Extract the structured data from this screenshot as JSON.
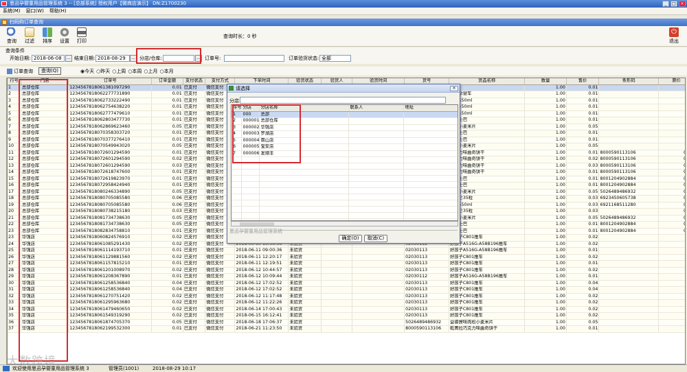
{
  "window": {
    "title": "思迅孕婴童用品管理系统 3 -- [总部系统] 授权用户【微商店演示】 DN:Z1700230"
  },
  "menu": [
    "系统(M)",
    "窗口(W)",
    "帮助(H)"
  ],
  "child_window": {
    "title": "扫码购订单查询"
  },
  "toolbar": {
    "items": [
      "查询",
      "过滤",
      "排序",
      "设置",
      "打印"
    ],
    "timer_label": "查询时长：",
    "timer_value": "0  秒",
    "exit": "退出"
  },
  "conditions": {
    "section": "查询条件",
    "start_label": "开始日期:",
    "start_value": "2018-06-08",
    "end_label": "结束日期:",
    "end_value": "2018-08-29",
    "branch_label": "分店/仓库:",
    "branch_value": "",
    "order_label": "订单号:",
    "order_value": "",
    "verify_label": "订单验货状态:",
    "verify_value": "全部"
  },
  "query_bar": {
    "tab": "订单查询",
    "query_btn": "查询(Q)",
    "periods": [
      "今天",
      "昨天",
      "上周",
      "本周",
      "上月",
      "本月"
    ]
  },
  "columns": [
    "行号",
    "门店",
    "订单号",
    "订单金额",
    "支付状态",
    "支付方式",
    "下单时间",
    "验货状态",
    "验货人",
    "验货时间",
    "货号",
    "货品名称",
    "数量",
    "售价",
    "条形码",
    "原价"
  ],
  "rows": [
    [
      "1",
      "总部仓库",
      "1234567818061381097290",
      "0.01",
      "已支付",
      "微信支付",
      "",
      "",
      "",
      "",
      "",
      "司乐",
      "1.00",
      "0.01",
      "",
      ""
    ],
    [
      "2",
      "总部仓库",
      "1234567818062277731890",
      "0.01",
      "已支付",
      "微信支付",
      "",
      "",
      "",
      "",
      "",
      "思迅孕婴车",
      "1.00",
      "0.01",
      "",
      ""
    ],
    [
      "3",
      "总部仓库",
      "1234567818062733222490",
      "0.01",
      "已支付",
      "微信支付",
      "",
      "",
      "",
      "",
      "",
      "山泉550ml",
      "1.00",
      "0.01",
      "",
      ""
    ],
    [
      "4",
      "总部仓库",
      "1234567818062754638220",
      "0.01",
      "已支付",
      "微信支付",
      "",
      "",
      "",
      "",
      "",
      "山泉550ml",
      "1.00",
      "0.01",
      "",
      ""
    ],
    [
      "5",
      "总部仓库",
      "1234567818062777479610",
      "0.01",
      "已支付",
      "微信支付",
      "",
      "",
      "",
      "",
      "",
      "山泉550ml",
      "1.00",
      "0.01",
      "",
      ""
    ],
    [
      "6",
      "总部仓库",
      "1234567818062803477730",
      "0.01",
      "已支付",
      "微信支付",
      "",
      "",
      "",
      "",
      "",
      "琪恩士巴",
      "1.00",
      "0.01",
      "",
      ""
    ],
    [
      "7",
      "总部仓库",
      "1234567818062869623460",
      "0.05",
      "已支付",
      "微信支付",
      "",
      "",
      "",
      "",
      "",
      "肉松小麦米片",
      "1.00",
      "0.05",
      "",
      ""
    ],
    [
      "8",
      "总部仓库",
      "1234567818070358303720",
      "0.01",
      "已支付",
      "微信支付",
      "",
      "",
      "",
      "",
      "",
      "琪恩士巴",
      "1.00",
      "0.01",
      "",
      ""
    ],
    [
      "9",
      "总部仓库",
      "1234567818070377276410",
      "0.01",
      "已支付",
      "微信支付",
      "",
      "",
      "",
      "",
      "",
      "琪恩士巴",
      "1.00",
      "0.01",
      "",
      ""
    ],
    [
      "10",
      "总部仓库",
      "1234567818070549943020",
      "0.05",
      "已支付",
      "微信支付",
      "",
      "",
      "",
      "",
      "",
      "肉松小麦米片",
      "1.00",
      "0.05",
      "",
      ""
    ],
    [
      "11",
      "总部仓库",
      "1234567818072601294590",
      "0.01",
      "已支付",
      "微信支付",
      "",
      "",
      "",
      "",
      "",
      "巧克力味曲奇饼干",
      "1.00",
      "0.01",
      "8000590113106",
      "0.02"
    ],
    [
      "12",
      "总部仓库",
      "1234567818072601294590",
      "0.02",
      "已支付",
      "微信支付",
      "",
      "",
      "",
      "",
      "",
      "巧克力味曲奇饼干",
      "1.00",
      "0.02",
      "8000590113106",
      "0.02"
    ],
    [
      "13",
      "总部仓库",
      "1234567818072601294590",
      "0.03",
      "已支付",
      "微信支付",
      "",
      "",
      "",
      "",
      "",
      "巧克力味曲奇饼干",
      "1.00",
      "0.03",
      "8000590113106",
      "0.02"
    ],
    [
      "14",
      "总部仓库",
      "1234567818072618747600",
      "0.01",
      "已支付",
      "微信支付",
      "",
      "",
      "",
      "",
      "",
      "巧克力味曲奇饼干",
      "1.00",
      "0.01",
      "8000590113106",
      "0.02"
    ],
    [
      "15",
      "总部仓库",
      "1234567818072619823970",
      "0.01",
      "已支付",
      "微信支付",
      "",
      "",
      "",
      "",
      "",
      "琪恩士巴",
      "1.00",
      "0.01",
      "8001204902884",
      "0.01"
    ],
    [
      "16",
      "总部仓库",
      "1234567818072958424940",
      "0.01",
      "已支付",
      "微信支付",
      "",
      "",
      "",
      "",
      "",
      "琪恩士巴",
      "1.00",
      "0.01",
      "8001204902884",
      "0.01"
    ],
    [
      "17",
      "总部仓库",
      "1234567818080246334890",
      "0.05",
      "已支付",
      "微信支付",
      "",
      "",
      "",
      "",
      "",
      "肉松小麦米片",
      "1.00",
      "0.05",
      "5026489486932",
      "0.05"
    ],
    [
      "18",
      "总部仓库",
      "1234567818080705085580",
      "0.06",
      "已支付",
      "微信支付",
      "",
      "",
      "",
      "",
      "",
      "果加仑35粒",
      "1.00",
      "0.03",
      "6923450605738",
      "0.03"
    ],
    [
      "19",
      "总部仓库",
      "1234567818080705085580",
      "0.06",
      "已支付",
      "微信支付",
      "",
      "",
      "",
      "",
      "",
      "山泉550ml",
      "1.00",
      "0.03",
      "6921168511280",
      "0.03"
    ],
    [
      "20",
      "总部仓库",
      "1234567818080738215180",
      "0.03",
      "已支付",
      "微信支付",
      "",
      "",
      "",
      "",
      "",
      "果加仑35粒",
      "1.00",
      "0.03",
      "",
      "0.03"
    ],
    [
      "21",
      "总部仓库",
      "1234567818081734738630",
      "0.05",
      "已支付",
      "微信支付",
      "",
      "",
      "",
      "",
      "",
      "肉松小麦米片",
      "1.00",
      "0.05",
      "5026489486932",
      "0.05"
    ],
    [
      "22",
      "总部仓库",
      "1234567818081734738630",
      "0.05",
      "已支付",
      "微信支付",
      "",
      "",
      "",
      "",
      "",
      "琪恩士巴",
      "1.00",
      "0.01",
      "8001204902884",
      "0.01"
    ],
    [
      "23",
      "总部仓库",
      "1234567818082834758810",
      "0.01",
      "已支付",
      "微信支付",
      "",
      "",
      "",
      "",
      "",
      "琪恩士巴",
      "1.00",
      "0.01",
      "8001204902884",
      "0.01"
    ],
    [
      "23",
      "华强店",
      "1234567818060824576910",
      "0.02",
      "已支付",
      "微信支付",
      "2018-06-08 13:43:01",
      "未验货",
      "",
      "",
      "02030113",
      "好孩子C801推车",
      "1.00",
      "0.02",
      "",
      ""
    ],
    [
      "24",
      "华强店",
      "1234567818061085291430",
      "0.02",
      "已支付",
      "微信支付",
      "2018-06-10 13:56:56",
      "未验货",
      "",
      "",
      "02030112",
      "好孩子A516G-A58B196推车",
      "1.00",
      "0.02",
      "",
      ""
    ],
    [
      "25",
      "华强店",
      "1234567818061114193710",
      "0.01",
      "已支付",
      "微信支付",
      "2018-06-11 09:00:36",
      "未验货",
      "",
      "",
      "02030113",
      "好孩子A516G-A58B196推车",
      "1.00",
      "0.01",
      "",
      ""
    ],
    [
      "26",
      "华强店",
      "1234567818061129881560",
      "0.02",
      "已支付",
      "微信支付",
      "2018-06-11 12:20:17",
      "未验货",
      "",
      "",
      "02030113",
      "好孩子C801推车",
      "1.00",
      "0.02",
      "",
      ""
    ],
    [
      "27",
      "华强店",
      "1234567818061157815210",
      "0.01",
      "已支付",
      "微信支付",
      "2018-06-11 12:19:51",
      "未验货",
      "",
      "",
      "02030113",
      "好孩子C801推车",
      "1.00",
      "0.01",
      "",
      ""
    ],
    [
      "28",
      "华强店",
      "1234567818061201008970",
      "0.02",
      "已支付",
      "微信支付",
      "2018-06-12 10:44:57",
      "未验货",
      "",
      "",
      "02030113",
      "好孩子C801推车",
      "1.00",
      "0.02",
      "",
      ""
    ],
    [
      "29",
      "华强店",
      "1234567818061208367890",
      "0.01",
      "已支付",
      "微信支付",
      "2018-06-12 10:09:44",
      "未验货",
      "",
      "",
      "02030112",
      "好孩子A516G-A58B196推车",
      "1.00",
      "0.01",
      "",
      ""
    ],
    [
      "30",
      "华强店",
      "1234567818061258536840",
      "0.04",
      "已支付",
      "微信支付",
      "2018-06-12 17:02:52",
      "未验货",
      "",
      "",
      "02030113",
      "好孩子C801推车",
      "1.00",
      "0.04",
      "",
      ""
    ],
    [
      "31",
      "华强店",
      "1234567818061258536840",
      "0.04",
      "已支付",
      "微信支付",
      "2018-06-12 17:02:52",
      "未验货",
      "",
      "",
      "02030113",
      "好孩子C801推车",
      "1.00",
      "0.04",
      "",
      ""
    ],
    [
      "32",
      "华强店",
      "1234567818061270751420",
      "0.02",
      "已支付",
      "微信支付",
      "2018-06-12 11:17:48",
      "未验货",
      "",
      "",
      "02030113",
      "好孩子C801推车",
      "1.00",
      "0.02",
      "",
      ""
    ],
    [
      "33",
      "华强店",
      "1234567818061295963680",
      "0.02",
      "已支付",
      "微信支付",
      "2018-06-12 11:22:26",
      "未验货",
      "",
      "",
      "02030113",
      "好孩子C801推车",
      "1.00",
      "0.02",
      "",
      ""
    ],
    [
      "34",
      "华强店",
      "1234567818061479460650",
      "0.02",
      "已支付",
      "微信支付",
      "2018-06-14 17:00:43",
      "未验货",
      "",
      "",
      "02030113",
      "好孩子C801推车",
      "1.00",
      "0.02",
      "",
      ""
    ],
    [
      "35",
      "华强店",
      "1234567818061549319290",
      "0.02",
      "已支付",
      "微信支付",
      "2018-06-15 16:12:41",
      "未验货",
      "",
      "",
      "02030113",
      "好孩子C801推车",
      "1.00",
      "0.02",
      "",
      ""
    ],
    [
      "36",
      "华强店",
      "1234567818061874705370",
      "0.05",
      "已支付",
      "微信支付",
      "2018-06-18 17:06:37",
      "未验货",
      "",
      "",
      "5026489486932",
      "益睿撩味肉松小麦米片",
      "1.00",
      "0.05",
      "",
      ""
    ],
    [
      "37",
      "华强店",
      "1234567818062199532300",
      "0.01",
      "已支付",
      "微信支付",
      "2018-06-21 11:23:50",
      "未验货",
      "",
      "",
      "8000590113106",
      "乾菁拉巧克力味曲奇饼干",
      "1.00",
      "0.01",
      "",
      ""
    ]
  ],
  "dialog": {
    "title": "请选择",
    "filter_label": "分店:",
    "filter_value": "",
    "columns": [
      "序号",
      "分店",
      "分店名称",
      "联系人",
      "地址"
    ],
    "rows": [
      [
        "1",
        "000",
        "总部",
        "",
        ""
      ],
      [
        "2",
        "000001",
        "总部仓库",
        "",
        ""
      ],
      [
        "3",
        "000002",
        "华强店",
        "",
        ""
      ],
      [
        "4",
        "000003",
        "罗湖店",
        "",
        ""
      ],
      [
        "5",
        "000004",
        "南山店",
        "",
        ""
      ],
      [
        "6",
        "000005",
        "宝安店",
        "",
        ""
      ],
      [
        "7",
        "000006",
        "发顺丰",
        "",
        ""
      ]
    ],
    "footer_label": "思迅孕婴童用品管理系统",
    "ok": "确定(O)",
    "cancel": "取消(C)"
  },
  "status": {
    "welcome": "欢迎使用思迅孕婴童用品管理系统 3",
    "user": "管理员(1001)",
    "datetime": "2018-08-29 10:17"
  },
  "watermark": "大数跨境"
}
